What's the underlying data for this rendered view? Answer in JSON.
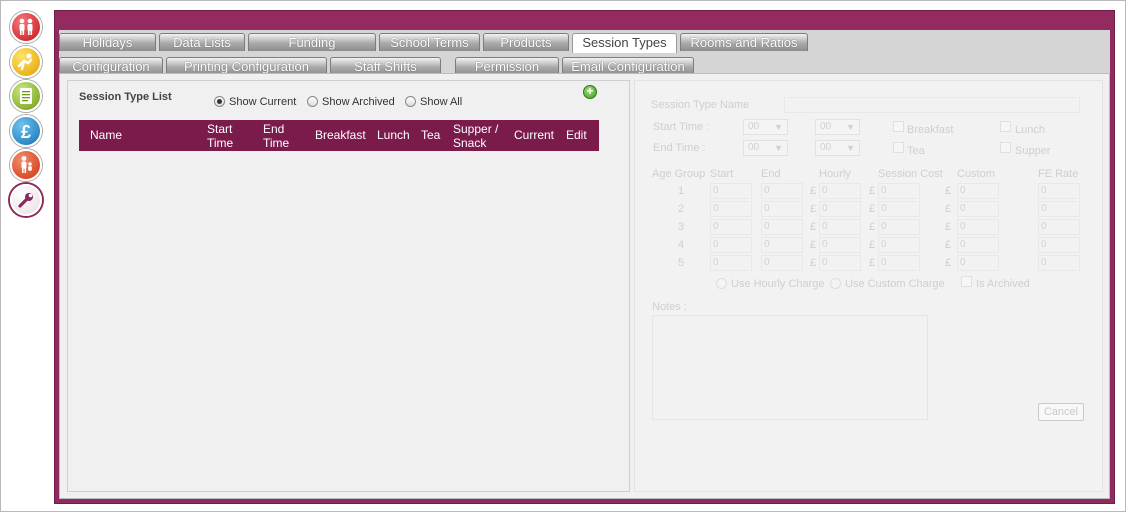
{
  "nav": {
    "icons": [
      "people-icon",
      "walking-child-icon",
      "document-icon",
      "pound-icon",
      "child-person-icon",
      "wrench-icon"
    ]
  },
  "tabs_row1": [
    "Holidays",
    "Data Lists",
    "Funding",
    "School Terms",
    "Products",
    "Session Types",
    "Rooms and Ratios"
  ],
  "tabs_row2": [
    "Configuration",
    "Printing Configuration",
    "Staff Shifts",
    "Permission",
    "Email Configuration"
  ],
  "active_tab": "Session Types",
  "list": {
    "title": "Session Type List",
    "filters": {
      "current": "Show Current",
      "archived": "Show Archived",
      "all": "Show All"
    },
    "selected_filter": "Show Current",
    "columns": {
      "name": "Name",
      "start1": "Start",
      "start2": "Time",
      "end1": "End",
      "end2": "Time",
      "breakfast": "Breakfast",
      "lunch": "Lunch",
      "tea": "Tea",
      "supper1": "Supper /",
      "supper2": "Snack",
      "current": "Current",
      "edit": "Edit"
    },
    "rows": []
  },
  "form": {
    "session_type_name_label": "Session Type Name",
    "start_time_label": "Start Time :",
    "end_time_label": "End Time :",
    "start_hour": "00",
    "start_min": "00",
    "end_hour": "00",
    "end_min": "00",
    "breakfast": "Breakfast",
    "lunch": "Lunch",
    "tea": "Tea",
    "supper": "Supper",
    "age_table": {
      "headers": {
        "age_group": "Age Group",
        "start": "Start",
        "end": "End",
        "hourly": "Hourly",
        "session_cost": "Session Cost",
        "custom": "Custom",
        "fe_rate": "FE Rate"
      },
      "currency": "£",
      "rows": [
        {
          "group": "1",
          "start": "0",
          "end": "0",
          "hourly": "0",
          "session_cost": "0",
          "custom": "0",
          "fe_rate": "0"
        },
        {
          "group": "2",
          "start": "0",
          "end": "0",
          "hourly": "0",
          "session_cost": "0",
          "custom": "0",
          "fe_rate": "0"
        },
        {
          "group": "3",
          "start": "0",
          "end": "0",
          "hourly": "0",
          "session_cost": "0",
          "custom": "0",
          "fe_rate": "0"
        },
        {
          "group": "4",
          "start": "0",
          "end": "0",
          "hourly": "0",
          "session_cost": "0",
          "custom": "0",
          "fe_rate": "0"
        },
        {
          "group": "5",
          "start": "0",
          "end": "0",
          "hourly": "0",
          "session_cost": "0",
          "custom": "0",
          "fe_rate": "0"
        }
      ]
    },
    "use_hourly": "Use Hourly Charge",
    "use_custom": "Use Custom Charge",
    "is_archived": "Is Archived",
    "notes_label": "Notes :",
    "cancel_label": "Cancel"
  },
  "colors": {
    "brand": "#8f2b5f",
    "header_row": "#7a1b4c"
  }
}
